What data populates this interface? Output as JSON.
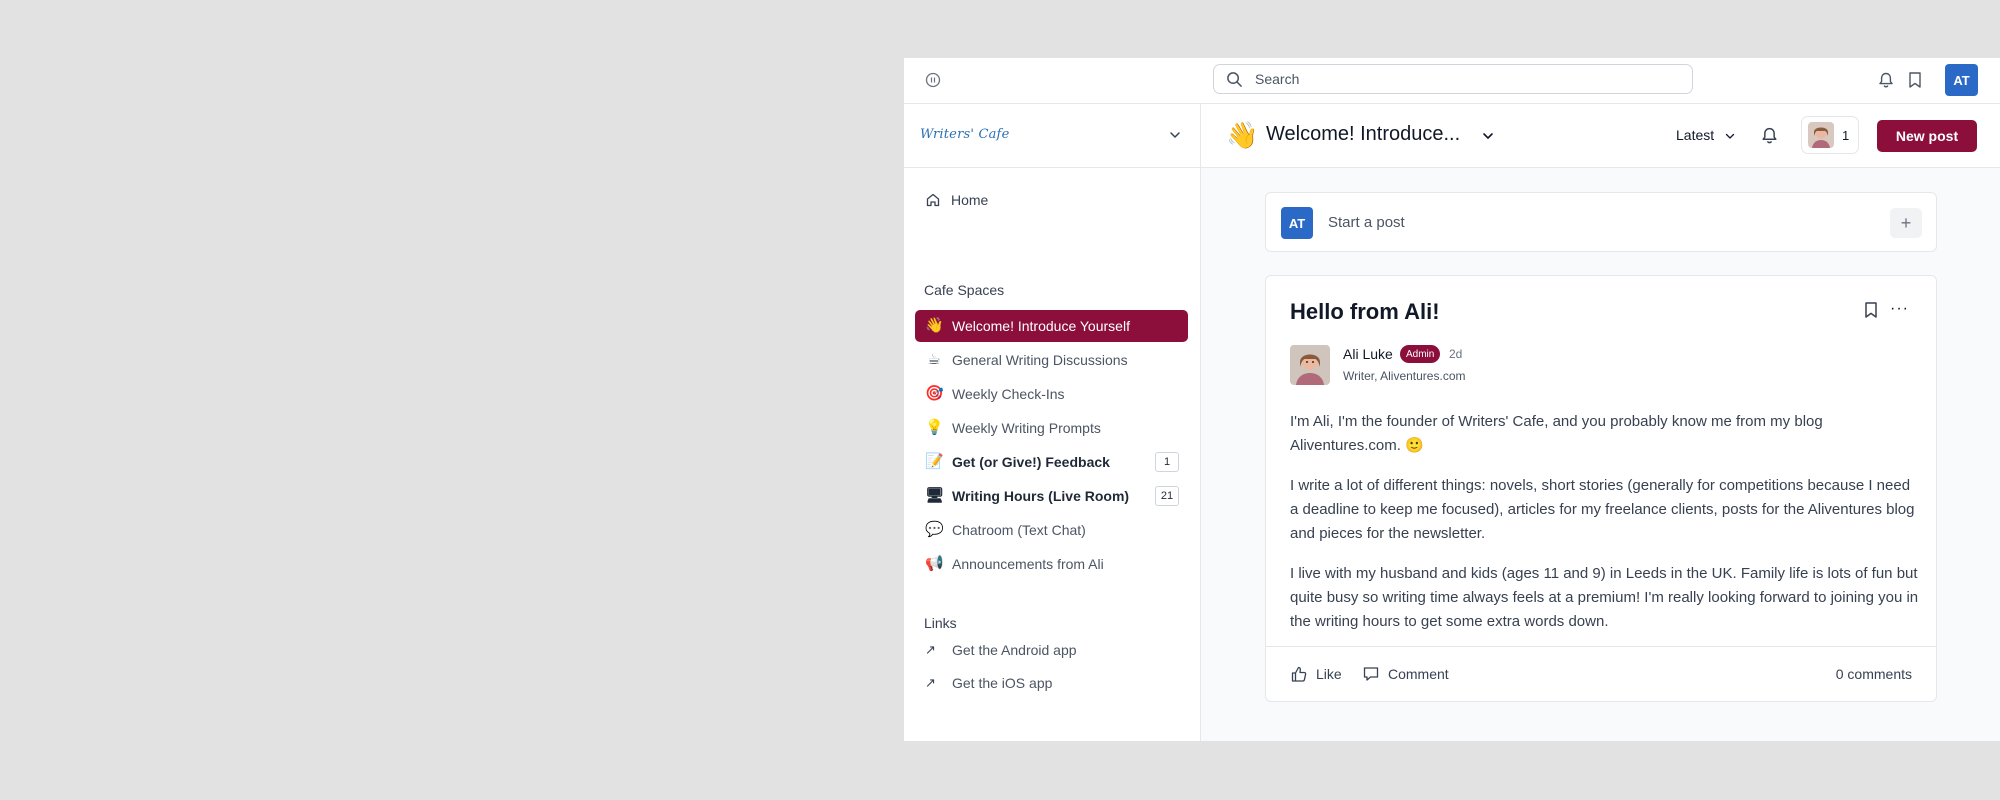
{
  "topbar": {
    "search_placeholder": "Search",
    "avatar_initials": "AT"
  },
  "sidebar": {
    "brand": "Writers' Cafe",
    "home": "Home",
    "spaces_title": "Cafe Spaces",
    "spaces": [
      {
        "emoji": "👋",
        "label": "Welcome! Introduce Yourself",
        "active": true,
        "bold": false,
        "count": ""
      },
      {
        "emoji": "☕",
        "label": "General Writing Discussions",
        "active": false,
        "bold": false,
        "count": ""
      },
      {
        "emoji": "🎯",
        "label": "Weekly Check-Ins",
        "active": false,
        "bold": false,
        "count": ""
      },
      {
        "emoji": "💡",
        "label": "Weekly Writing Prompts",
        "active": false,
        "bold": false,
        "count": ""
      },
      {
        "emoji": "📝",
        "label": "Get (or Give!) Feedback",
        "active": false,
        "bold": true,
        "count": "1"
      },
      {
        "emoji": "🖥",
        "label": "Writing Hours (Live Room)",
        "active": false,
        "bold": true,
        "count": "21"
      },
      {
        "emoji": "💬",
        "label": "Chatroom (Text Chat)",
        "active": false,
        "bold": false,
        "count": ""
      },
      {
        "emoji": "📢",
        "label": "Announcements from Ali",
        "active": false,
        "bold": false,
        "count": ""
      }
    ],
    "links_title": "Links",
    "links": [
      {
        "label": "Get the Android app"
      },
      {
        "label": "Get the iOS app"
      }
    ]
  },
  "header": {
    "emoji": "👋",
    "title": "Welcome! Introduce...",
    "sort_label": "Latest",
    "members_count": "1",
    "new_post_label": "New post"
  },
  "composer": {
    "avatar_initials": "AT",
    "placeholder": "Start a post",
    "plus": "+"
  },
  "post": {
    "title": "Hello from Ali!",
    "author": "Ali Luke",
    "badge": "Admin",
    "time": "2d",
    "author_headline": "Writer, Aliventures.com",
    "paragraphs": [
      "I'm Ali, I'm the founder of Writers' Cafe, and you probably know me from my blog Aliventures.com. 🙂",
      "I write a lot of different things: novels, short stories (generally for competitions because I need a deadline to keep me focused), articles for my freelance clients, posts for the Aliventures blog and pieces for the newsletter.",
      "I live with my husband and kids (ages 11 and 9) in Leeds in the UK. Family life is lots of fun but quite busy so writing time always feels at a premium! I'm really looking forward to joining you in the writing hours to get some extra words down."
    ],
    "like_label": "Like",
    "comment_label": "Comment",
    "comments_count": "0 comments"
  },
  "colors": {
    "brand": "#8b0f3a",
    "avatar_blue": "#2a6ac6"
  }
}
